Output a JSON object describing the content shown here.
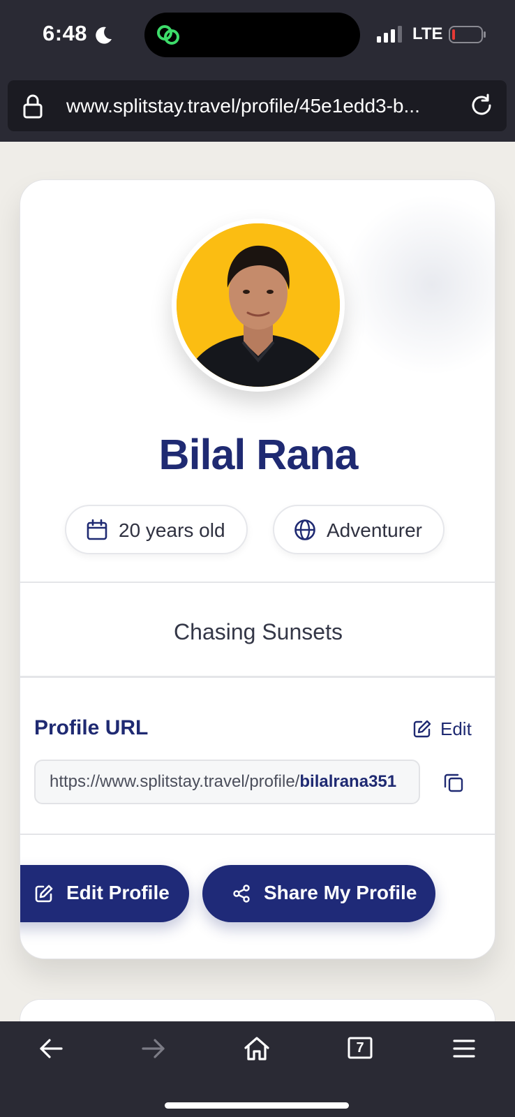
{
  "status_bar": {
    "time": "6:48",
    "network": "LTE",
    "icons": [
      "moon-icon",
      "link-app-icon",
      "signal-icon",
      "battery-icon"
    ]
  },
  "browser": {
    "url": "www.splitstay.travel/profile/45e1edd3-b...",
    "tab_count": "7",
    "icons": [
      "lock-icon",
      "reload-icon",
      "back-icon",
      "forward-icon",
      "home-icon",
      "tabs-icon",
      "menu-icon"
    ]
  },
  "profile": {
    "name": "Bilal Rana",
    "age": "20 years old",
    "traveler_type": "Adventurer",
    "tagline": "Chasing Sunsets",
    "url_section_title": "Profile URL",
    "edit_label": "Edit",
    "url_base": "https://www.splitstay.travel/profile/",
    "url_handle": "bilalrana351"
  },
  "actions": {
    "edit_profile": "Edit Profile",
    "share_profile": "Share My Profile"
  },
  "colors": {
    "brand_navy": "#1f2a78",
    "chrome_dark": "#2a2a34",
    "avatar_background": "#fbbd12",
    "battery_low": "#e53935"
  }
}
